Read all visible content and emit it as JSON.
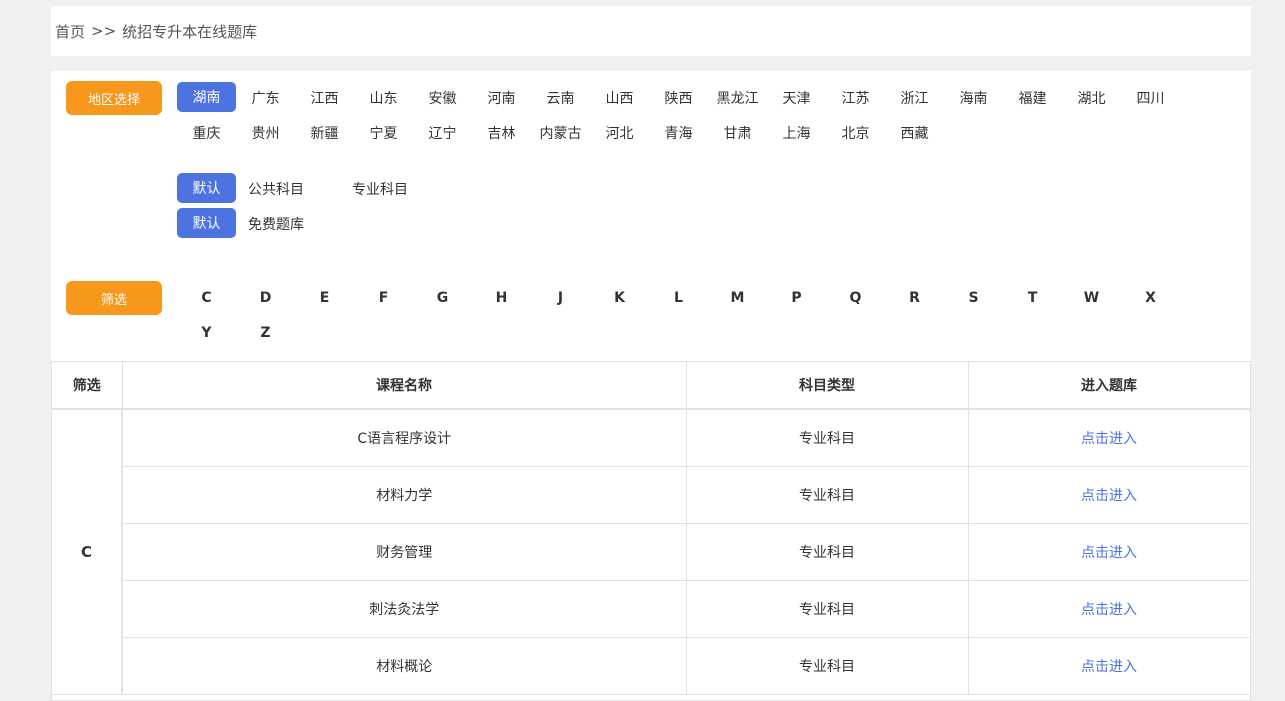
{
  "breadcrumb": {
    "home": "首页",
    "sep": ">>",
    "current": "统招专升本在线题库"
  },
  "region": {
    "label": "地区选择",
    "items": [
      "湖南",
      "广东",
      "江西",
      "山东",
      "安徽",
      "河南",
      "云南",
      "山西",
      "陕西",
      "黑龙江",
      "天津",
      "江苏",
      "浙江",
      "海南",
      "福建",
      "湖北",
      "四川",
      "重庆",
      "贵州",
      "新疆",
      "宁夏",
      "辽宁",
      "吉林",
      "内蒙古",
      "河北",
      "青海",
      "甘肃",
      "上海",
      "北京",
      "西藏"
    ],
    "active_index": 0
  },
  "subject_type": {
    "default_label": "默认",
    "items": [
      "公共科目",
      "专业科目"
    ]
  },
  "bank_type": {
    "default_label": "默认",
    "items": [
      "免费题库"
    ]
  },
  "filter": {
    "label": "筛选",
    "letters": [
      "C",
      "D",
      "E",
      "F",
      "G",
      "H",
      "J",
      "K",
      "L",
      "M",
      "P",
      "Q",
      "R",
      "S",
      "T",
      "W",
      "X",
      "Y",
      "Z"
    ]
  },
  "table": {
    "headers": [
      "筛选",
      "课程名称",
      "科目类型",
      "进入题库"
    ],
    "group_letter": "C",
    "rows": [
      {
        "name": "C语言程序设计",
        "type": "专业科目",
        "action": "点击进入"
      },
      {
        "name": "材料力学",
        "type": "专业科目",
        "action": "点击进入"
      },
      {
        "name": "财务管理",
        "type": "专业科目",
        "action": "点击进入"
      },
      {
        "name": "刺法灸法学",
        "type": "专业科目",
        "action": "点击进入"
      },
      {
        "name": "材料概论",
        "type": "专业科目",
        "action": "点击进入"
      }
    ]
  },
  "colors": {
    "accent_blue": "#4c73e0",
    "accent_orange": "#f7981d"
  }
}
